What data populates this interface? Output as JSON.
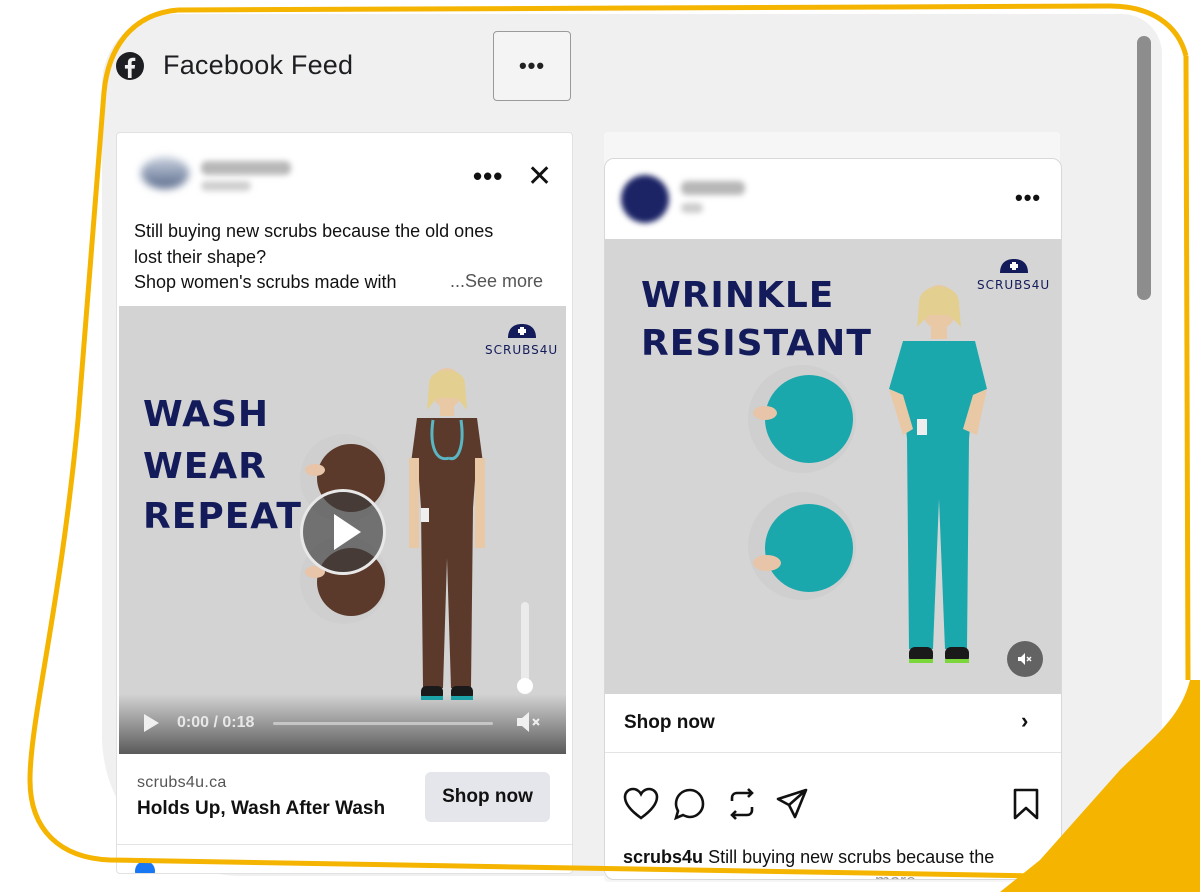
{
  "panel": {
    "title": "Facebook Feed",
    "more_label": "•••",
    "accent_color": "#f5b400"
  },
  "facebook_ad": {
    "options_label": "•••",
    "close_label": "✕",
    "text_line_1": "Still buying new scrubs because the old ones",
    "text_line_2": "lost their shape?",
    "text_line_3": "Shop women's scrubs made with",
    "see_more": "...See more",
    "brand_logo": "SCRUBS4U",
    "video_headline": [
      "WASH",
      "WEAR",
      "REPEAT"
    ],
    "video_time": "0:00 / 0:18",
    "video_progress": 0.0,
    "domain": "scrubs4u.ca",
    "headline": "Holds Up, Wash After Wash",
    "cta": "Shop now",
    "scrub_color": "#5b3a2c"
  },
  "instagram_ad": {
    "options_label": "•••",
    "brand_logo": "SCRUBS4U",
    "image_headline_1": "WRINKLE",
    "image_headline_2": "RESISTANT",
    "cta": "Shop now",
    "caption_user": "scrubs4u",
    "caption_text": "Still buying new scrubs because the",
    "caption_more": "... more",
    "scrub_color": "#1aa8ad",
    "action_icons": [
      "heart-icon",
      "comment-icon",
      "repost-icon",
      "share-icon",
      "bookmark-icon"
    ]
  }
}
